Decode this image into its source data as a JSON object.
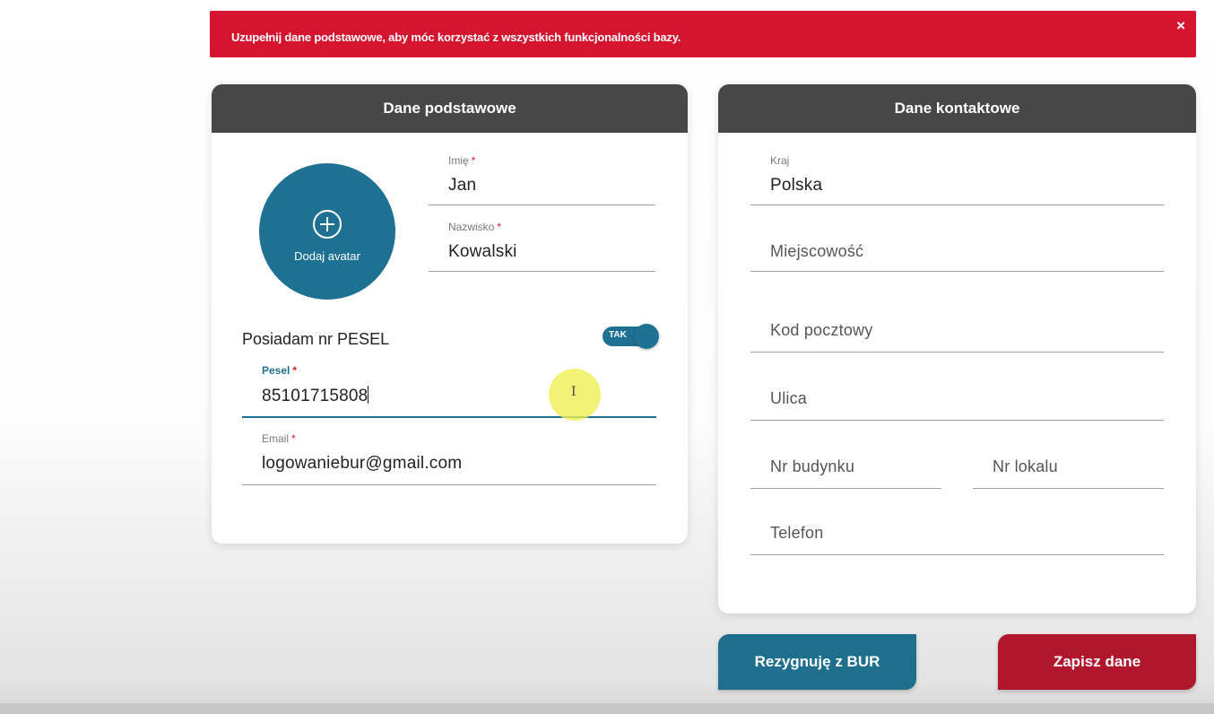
{
  "alert": {
    "message": "Uzupełnij dane podstawowe, aby móc korzystać z wszystkich funkcjonalności bazy.",
    "close_symbol": "×"
  },
  "basic": {
    "title": "Dane podstawowe",
    "avatar_label": "Dodaj avatar",
    "first_name": {
      "label": "Imię",
      "value": "Jan"
    },
    "last_name": {
      "label": "Nazwisko",
      "value": "Kowalski"
    },
    "pesel_question": "Posiadam nr PESEL",
    "pesel_toggle": {
      "label": "TAK",
      "on": true
    },
    "pesel": {
      "label": "Pesel",
      "value": "85101715808"
    },
    "email": {
      "label": "Email",
      "value": "logowaniebur@gmail.com"
    },
    "required_marker": "*"
  },
  "contact": {
    "title": "Dane kontaktowe",
    "country": {
      "label": "Kraj",
      "value": "Polska"
    },
    "city_placeholder": "Miejscowość",
    "postal_code_placeholder": "Kod pocztowy",
    "street_placeholder": "Ulica",
    "building_number_placeholder": "Nr budynku",
    "apartment_number_placeholder": "Nr lokalu",
    "phone_placeholder": "Telefon"
  },
  "buttons": {
    "resign": "Rezygnuję z BUR",
    "save": "Zapisz dane"
  },
  "mouse_cursor_glyph": "I",
  "colors": {
    "alert_red": "#d5152f",
    "header_dark": "#474747",
    "primary_blue": "#1e7193",
    "save_red": "#b0172c",
    "cursor_highlight": "#eef050"
  }
}
